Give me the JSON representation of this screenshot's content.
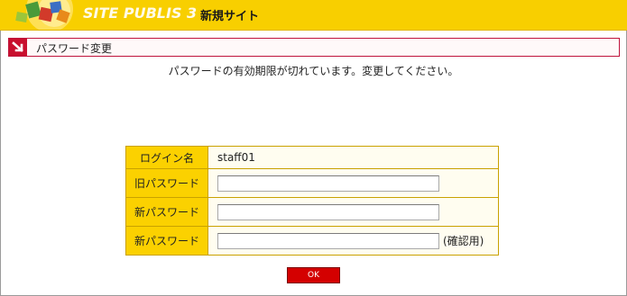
{
  "header": {
    "logo_text": "SITE PUBLIS 3",
    "site_name": "新規サイト"
  },
  "section": {
    "title": "パスワード変更"
  },
  "message": "パスワードの有効期限が切れています。変更してください。",
  "form": {
    "login_label": "ログイン名",
    "login_value": "staff01",
    "old_password_label": "旧パスワード",
    "old_password_value": "",
    "new_password_label": "新パスワード",
    "new_password_value": "",
    "confirm_password_label": "新パスワード",
    "confirm_password_value": "",
    "confirm_note": "(確認用)"
  },
  "actions": {
    "ok_label": "OK"
  },
  "colors": {
    "header": "#f8cf00",
    "label_cell": "#fbd100",
    "accent_red": "#c8102e",
    "ok_button": "#d40000"
  }
}
